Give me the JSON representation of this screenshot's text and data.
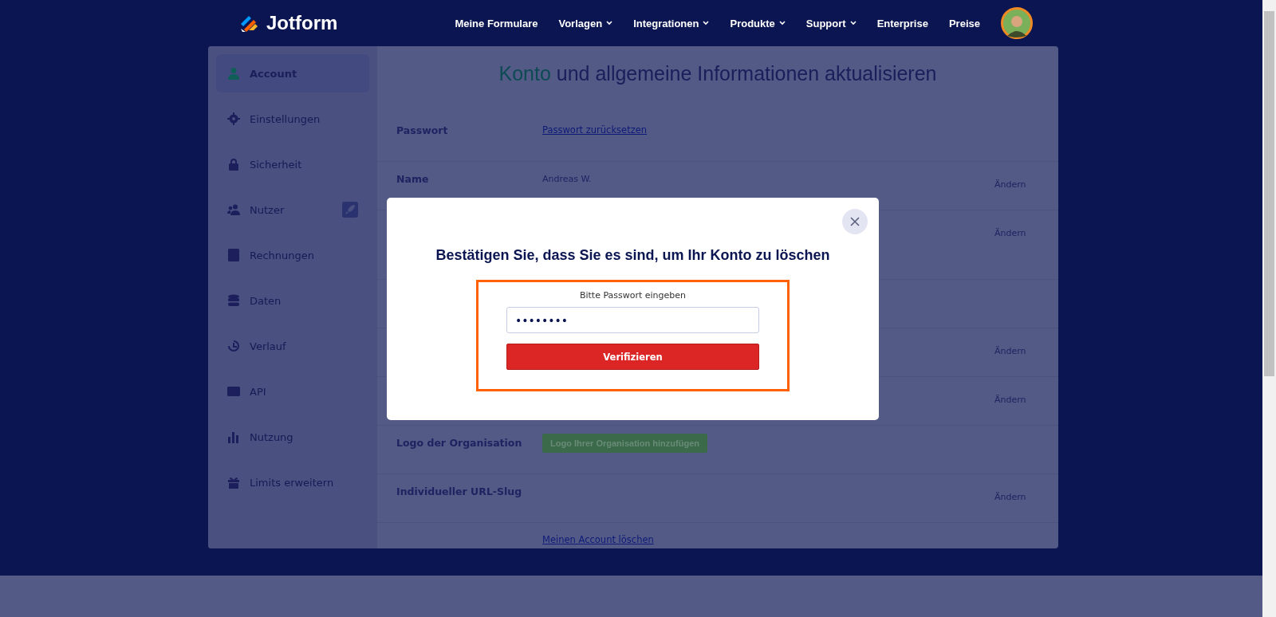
{
  "nav": {
    "logo": "Jotform",
    "links": [
      {
        "label": "Meine Formulare",
        "dropdown": false
      },
      {
        "label": "Vorlagen",
        "dropdown": true
      },
      {
        "label": "Integrationen",
        "dropdown": true
      },
      {
        "label": "Produkte",
        "dropdown": true
      },
      {
        "label": "Support",
        "dropdown": true
      },
      {
        "label": "Enterprise",
        "dropdown": false
      },
      {
        "label": "Preise",
        "dropdown": false
      }
    ]
  },
  "sidebar": {
    "items": [
      {
        "label": "Account",
        "selected": true,
        "badge": false
      },
      {
        "label": "Einstellungen",
        "selected": false,
        "badge": false
      },
      {
        "label": "Sicherheit",
        "selected": false,
        "badge": false
      },
      {
        "label": "Nutzer",
        "selected": false,
        "badge": true
      },
      {
        "label": "Rechnungen",
        "selected": false,
        "badge": false
      },
      {
        "label": "Daten",
        "selected": false,
        "badge": false
      },
      {
        "label": "Verlauf",
        "selected": false,
        "badge": false
      },
      {
        "label": "API",
        "selected": false,
        "badge": false
      },
      {
        "label": "Nutzung",
        "selected": false,
        "badge": false
      },
      {
        "label": "Limits erweitern",
        "selected": false,
        "badge": false
      }
    ]
  },
  "main": {
    "title": "**Konto** und allgemeine Informationen aktualisieren",
    "rows": [
      {
        "label": "Passwort",
        "value": "Passwort zurücksetzen",
        "kind": "link"
      },
      {
        "label": "Name",
        "value": "Andreas W.",
        "kind": "text",
        "action": "Ändern"
      },
      {
        "action": "Ändern"
      },
      {},
      {
        "action": "Ändern"
      },
      {
        "action": "Ändern"
      },
      {
        "label": "Logo der Organisation",
        "value": "Logo Ihrer Organisation hinzufügen",
        "kind": "button"
      },
      {
        "label": "Individueller URL-Slug",
        "action": "Ändern"
      },
      {
        "value": "Meinen Account löschen",
        "kind": "link"
      }
    ]
  },
  "modal": {
    "title": "Bestätigen Sie, dass Sie es sind, um Ihr Konto zu löschen",
    "field_label": "Bitte Passwort eingeben",
    "password_value": "••••••••",
    "button": "Verifizieren"
  }
}
